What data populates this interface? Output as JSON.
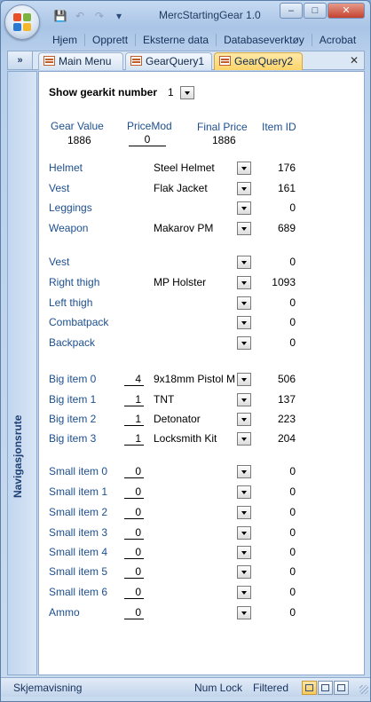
{
  "window": {
    "title": "MercStartingGear 1.0",
    "qat": {
      "save": "💾",
      "undo": "↶",
      "redo": "↷",
      "customize": "▾"
    },
    "controls": {
      "minimize": "–",
      "maximize": "□",
      "close": "✕"
    }
  },
  "ribbon": {
    "tabs": [
      "Hjem",
      "Opprett",
      "Eksterne data",
      "Databaseverktøy",
      "Acrobat"
    ],
    "help": "?"
  },
  "doc_tabs": {
    "toggle": "»",
    "tabs": [
      {
        "label": "Main Menu",
        "active": false
      },
      {
        "label": "GearQuery1",
        "active": false
      },
      {
        "label": "GearQuery2",
        "active": true
      }
    ],
    "close": "✕"
  },
  "nav_pane": {
    "label": "Navigasjonsrute"
  },
  "form": {
    "gearkit": {
      "label": "Show gearkit number",
      "value": "1"
    },
    "summary": {
      "gear_value_label": "Gear Value",
      "gear_value": "1886",
      "pricemod_label": "PriceMod",
      "pricemod": "0",
      "final_price_label": "Final Price",
      "final_price": "1886",
      "item_id_label": "Item ID"
    },
    "slots": [
      {
        "label": "Helmet",
        "item": "Steel Helmet",
        "id": "176"
      },
      {
        "label": "Vest",
        "item": "Flak Jacket",
        "id": "161"
      },
      {
        "label": "Leggings",
        "item": "",
        "id": "0"
      },
      {
        "label": "Weapon",
        "item": "Makarov PM",
        "id": "689"
      }
    ],
    "lbe": [
      {
        "label": "Vest",
        "item": "",
        "id": "0"
      },
      {
        "label": "Right thigh",
        "item": "MP Holster",
        "id": "1093"
      },
      {
        "label": "Left thigh",
        "item": "",
        "id": "0"
      },
      {
        "label": "Combatpack",
        "item": "",
        "id": "0"
      },
      {
        "label": "Backpack",
        "item": "",
        "id": "0"
      }
    ],
    "big_items": [
      {
        "label": "Big item 0",
        "qty": "4",
        "item": "9x18mm Pistol M",
        "id": "506"
      },
      {
        "label": "Big item 1",
        "qty": "1",
        "item": "TNT",
        "id": "137"
      },
      {
        "label": "Big item 2",
        "qty": "1",
        "item": "Detonator",
        "id": "223"
      },
      {
        "label": "Big item 3",
        "qty": "1",
        "item": "Locksmith Kit",
        "id": "204"
      }
    ],
    "small_items": [
      {
        "label": "Small item 0",
        "qty": "0",
        "item": "",
        "id": "0"
      },
      {
        "label": "Small item 1",
        "qty": "0",
        "item": "",
        "id": "0"
      },
      {
        "label": "Small item 2",
        "qty": "0",
        "item": "",
        "id": "0"
      },
      {
        "label": "Small item 3",
        "qty": "0",
        "item": "",
        "id": "0"
      },
      {
        "label": "Small item 4",
        "qty": "0",
        "item": "",
        "id": "0"
      },
      {
        "label": "Small item 5",
        "qty": "0",
        "item": "",
        "id": "0"
      },
      {
        "label": "Small item 6",
        "qty": "0",
        "item": "",
        "id": "0"
      },
      {
        "label": "Ammo",
        "qty": "0",
        "item": "",
        "id": "0"
      }
    ]
  },
  "statusbar": {
    "left": "Skjemavisning",
    "numlock": "Num Lock",
    "filtered": "Filtered"
  },
  "colors": {
    "label_blue": "#1d4f8f",
    "active_tab": "#fbd46a",
    "frame": "#b9d0ec"
  }
}
